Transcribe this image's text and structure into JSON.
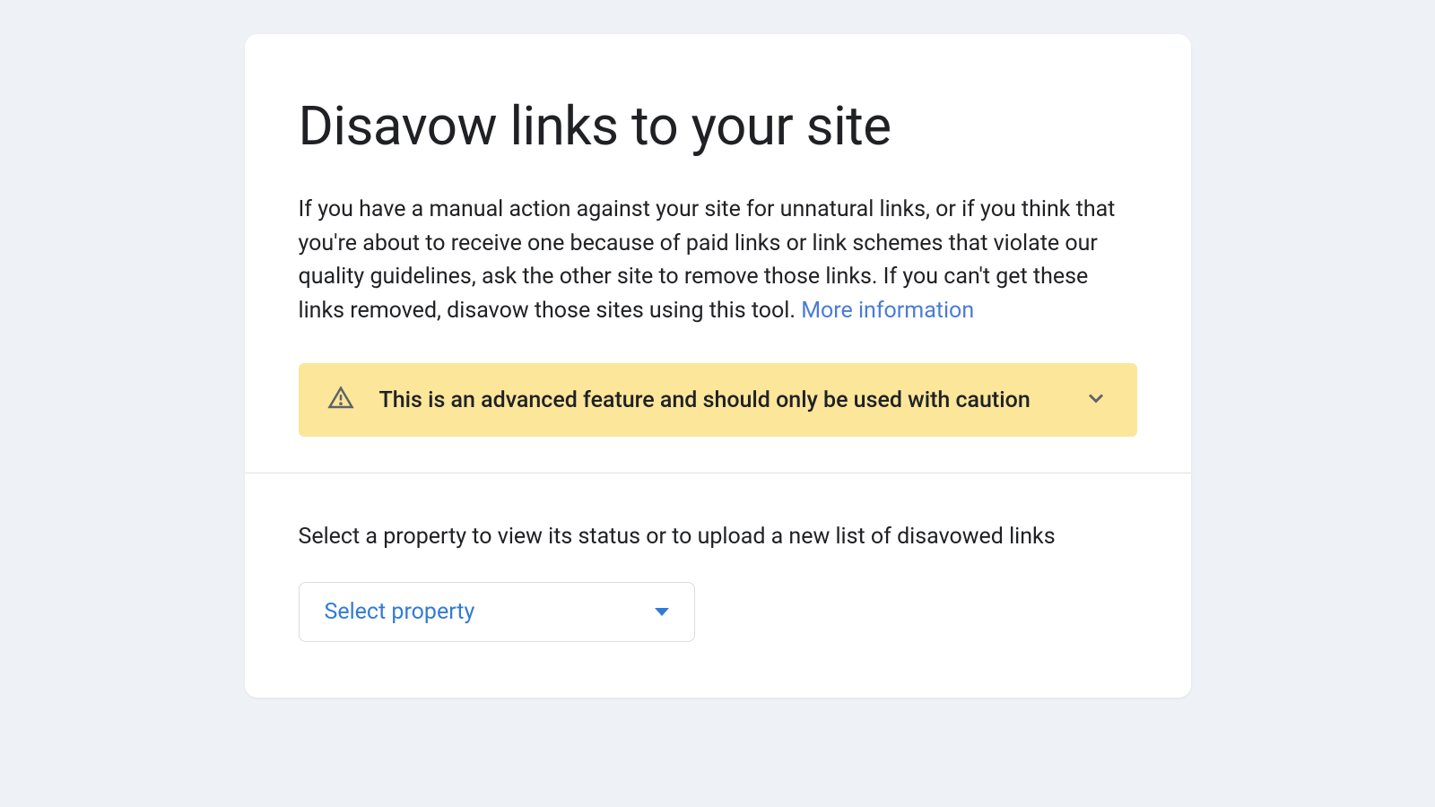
{
  "title": "Disavow links to your site",
  "description_text": "If you have a manual action against your site for unnatural links, or if you think that you're about to receive one because of paid links or link schemes that violate our quality guidelines, ask the other site to remove those links. If you can't get these links removed, disavow those sites using this tool. ",
  "more_link_text": "More information",
  "warning_text": "This is an advanced feature and should only be used with caution",
  "select_label": "Select a property to view its status or to upload a new list of disavowed links",
  "dropdown": {
    "selected": "Select property"
  }
}
